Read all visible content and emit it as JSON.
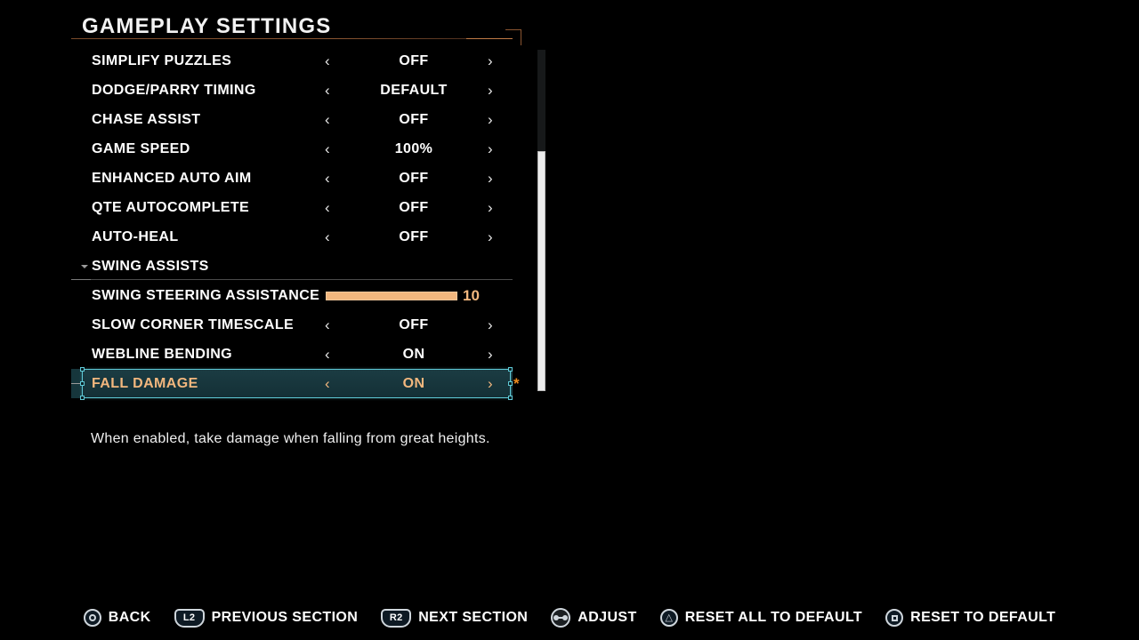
{
  "header": {
    "title": "GAMEPLAY SETTINGS"
  },
  "settings": {
    "rows": [
      {
        "label": "SIMPLIFY PUZZLES",
        "value": "OFF"
      },
      {
        "label": "DODGE/PARRY TIMING",
        "value": "DEFAULT"
      },
      {
        "label": "CHASE ASSIST",
        "value": "OFF"
      },
      {
        "label": "GAME SPEED",
        "value": "100%"
      },
      {
        "label": "ENHANCED AUTO AIM",
        "value": "OFF"
      },
      {
        "label": "QTE AUTOCOMPLETE",
        "value": "OFF"
      },
      {
        "label": "AUTO-HEAL",
        "value": "OFF"
      },
      {
        "label": "SWING ASSISTS",
        "value": ""
      },
      {
        "label": "SWING STEERING ASSISTANCE",
        "value": "10"
      },
      {
        "label": "SLOW CORNER TIMESCALE",
        "value": "OFF"
      },
      {
        "label": "WEBLINE BENDING",
        "value": "ON"
      },
      {
        "label": "FALL DAMAGE",
        "value": "ON"
      }
    ],
    "slider": {
      "label": "SWING STEERING ASSISTANCE",
      "value": "10",
      "fill_percent": 100
    },
    "selected": {
      "label": "FALL DAMAGE",
      "value": "ON",
      "modified_marker": "*"
    },
    "arrow_left": "‹",
    "arrow_right": "›"
  },
  "description": {
    "text": "When enabled, take damage when falling from great heights."
  },
  "prompts": [
    {
      "icon": "circle-button-icon",
      "label": "BACK"
    },
    {
      "icon": "l2-button-icon",
      "label": "PREVIOUS SECTION",
      "button": "L2"
    },
    {
      "icon": "r2-button-icon",
      "label": "NEXT SECTION",
      "button": "R2"
    },
    {
      "icon": "dpad-horizontal-icon",
      "label": "ADJUST"
    },
    {
      "icon": "triangle-button-icon",
      "label": "RESET ALL TO DEFAULT",
      "glyph": "△"
    },
    {
      "icon": "square-button-icon",
      "label": "RESET TO DEFAULT"
    }
  ],
  "colors": {
    "accent_orange": "#f2b77e",
    "selection_border": "#5fc9d6",
    "selection_bg": "#16363c",
    "modified_star": "#f08c1e",
    "title_rule": "#8a5531"
  }
}
